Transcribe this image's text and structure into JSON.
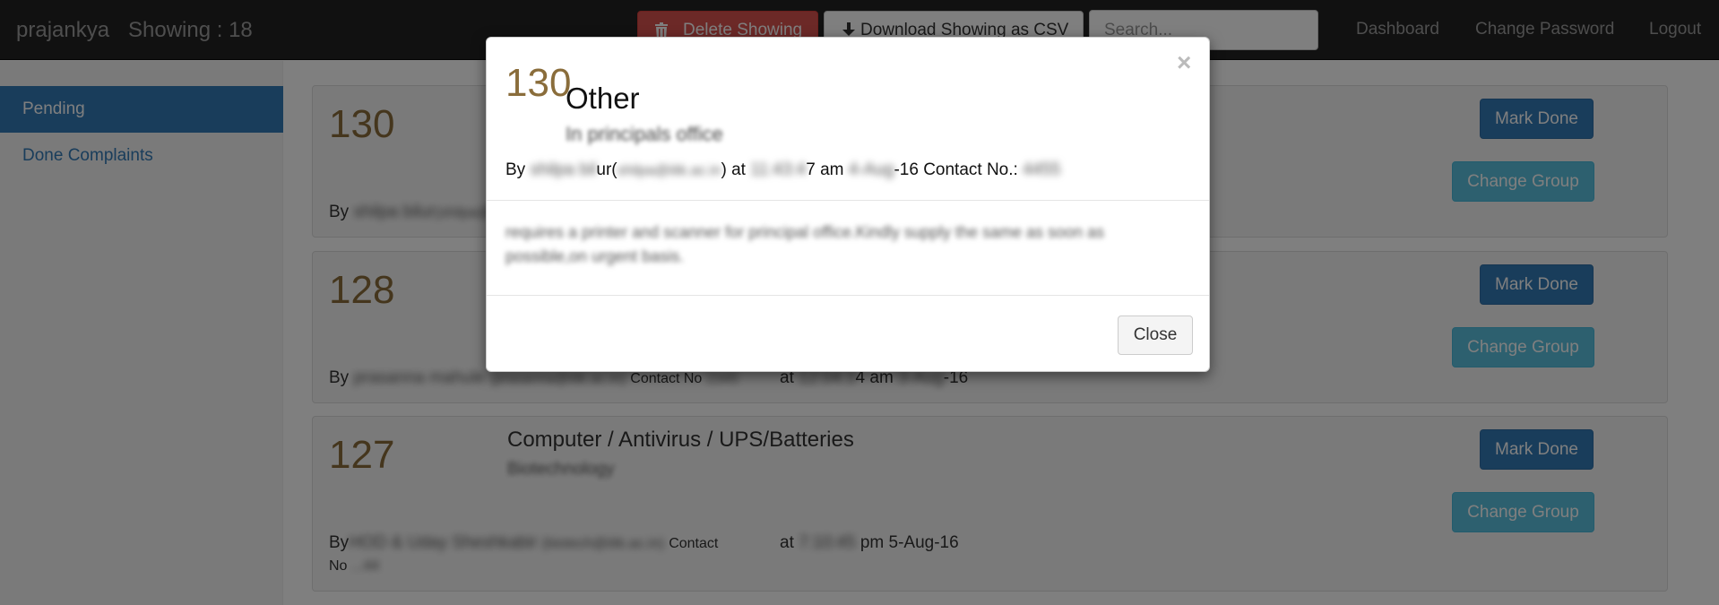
{
  "navbar": {
    "brand": "prajankya",
    "showing": "Showing : 18",
    "delete_label": "Delete Showing",
    "download_label": "Download Showing as CSV",
    "search_placeholder": "Search...",
    "links": [
      "Dashboard",
      "Change Password",
      "Logout"
    ]
  },
  "sidebar": {
    "items": [
      {
        "label": "Pending",
        "active": true
      },
      {
        "label": "Done Complaints",
        "active": false
      }
    ]
  },
  "complaints": [
    {
      "number": "130",
      "by_prefix": "By",
      "by_name": "shilpa bilur",
      "by_email": "(shilpa@",
      "mark_done": "Mark Done",
      "change_group": "Change Group"
    },
    {
      "number": "128",
      "by_prefix": "By",
      "by_name": "prasanna mahule",
      "by_email": "(prasanna@iitk.ac.in)",
      "contact_label": "Contact No",
      "contact_value": "2345",
      "at_label": "at",
      "time_blur": "12:04:3",
      "time_rest": "4 am",
      "date_blur": "3-Aug",
      "date_rest": "-16",
      "mark_done": "Mark Done",
      "change_group": "Change Group"
    },
    {
      "number": "127",
      "category": "Computer / Antivirus / UPS/Batteries",
      "department": "Biotechnology",
      "by_prefix": "By",
      "by_name": "HOD & Uday Sheshkabir",
      "by_email": "(biotech@iitk.ac.in)",
      "contact_label": "Contact",
      "contact_label2": "No",
      "contact_value": "...44",
      "at_label": "at",
      "time_blur": "7:10:45",
      "time_rest": "pm",
      "date_rest": "5-Aug-16",
      "mark_done": "Mark Done",
      "change_group": "Change Group"
    }
  ],
  "modal": {
    "number": "130",
    "title": "Other",
    "subtitle": "In principals office",
    "by_prefix": "By",
    "by_name_blur": "shilpa bil",
    "by_name_rest": "ur(",
    "by_email_blur": "shilpa@iitk.ac.in",
    "by_email_close": ")",
    "at_label": "at",
    "time_blur": "11:43:4",
    "time_rest": "7 am",
    "date_blur": "4-Aug",
    "date_rest": "-16 Contact No.:",
    "contact_blur": "4455",
    "body": "requires a printer and scanner for principal office.Kindly supply the same as soon as possible,on urgent basis.",
    "close_label": "Close"
  }
}
